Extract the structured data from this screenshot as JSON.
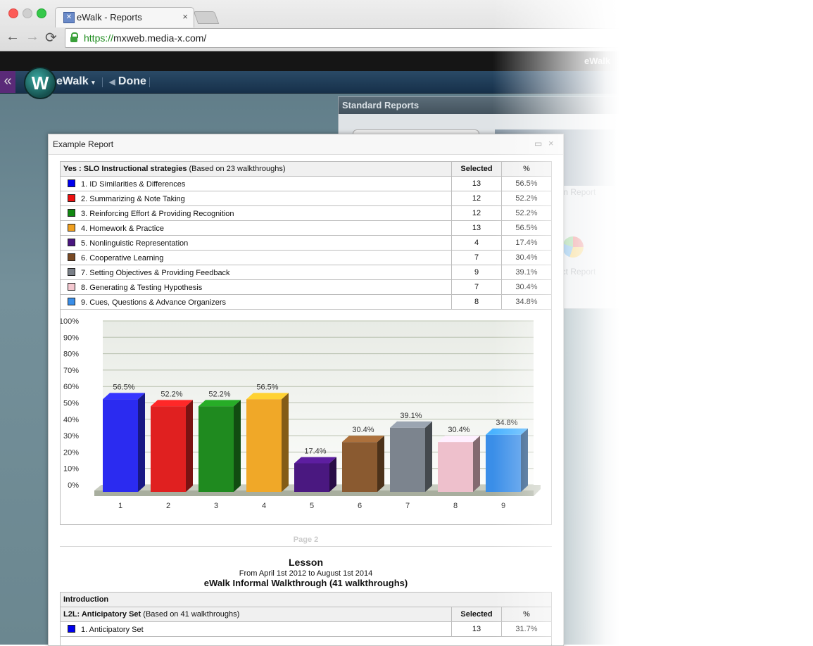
{
  "browser": {
    "tab_title": "eWalk - Reports",
    "tab_close": "×",
    "url_scheme": "https://",
    "url_rest": "mxweb.media-x.com/",
    "back_glyph": "←",
    "forward_glyph": "→",
    "reload_glyph": "⟳",
    "icons": [
      "back-icon",
      "forward-icon",
      "reload-icon",
      "lock-icon",
      "favicon"
    ]
  },
  "app": {
    "brand": "eWalk",
    "menu_app": "eWalk",
    "menu_done": "Done",
    "back_glyph": "«",
    "logo_letter": "W",
    "done_glyph": "◀"
  },
  "background_panel": {
    "title": "Standard Reports",
    "label_1": "ion Report",
    "label_2": "ect Report"
  },
  "modal": {
    "title": "Example Report",
    "max_glyph": "🗖",
    "close_glyph": "×"
  },
  "report": {
    "header_bold": "Yes : SLO Instructional strategies",
    "header_normal": "(Based on 23 walkthroughs)",
    "col_selected": "Selected",
    "col_pct": "%",
    "rows": [
      {
        "label": "1. ID Similarities & Differences",
        "selected": "13",
        "pct": "56.5%",
        "color": "#0000ee"
      },
      {
        "label": "2. Summarizing & Note Taking",
        "selected": "12",
        "pct": "52.2%",
        "color": "#ee1111"
      },
      {
        "label": "3. Reinforcing Effort & Providing Recognition",
        "selected": "12",
        "pct": "52.2%",
        "color": "#118811"
      },
      {
        "label": "4. Homework & Practice",
        "selected": "13",
        "pct": "56.5%",
        "color": "#f0a020"
      },
      {
        "label": "5. Nonlinguistic Representation",
        "selected": "4",
        "pct": "17.4%",
        "color": "#4a1680"
      },
      {
        "label": "6. Cooperative Learning",
        "selected": "7",
        "pct": "30.4%",
        "color": "#7a4a24"
      },
      {
        "label": "7. Setting Objectives & Providing Feedback",
        "selected": "9",
        "pct": "39.1%",
        "color": "#7a8088"
      },
      {
        "label": "8. Generating & Testing Hypothesis",
        "selected": "7",
        "pct": "30.4%",
        "color": "#f4c8d0"
      },
      {
        "label": "9. Cues, Questions & Advance Organizers",
        "selected": "8",
        "pct": "34.8%",
        "color": "#3a8ee8"
      }
    ]
  },
  "chart_data": {
    "type": "bar",
    "categories": [
      "1",
      "2",
      "3",
      "4",
      "5",
      "6",
      "7",
      "8",
      "9"
    ],
    "values": [
      56.5,
      52.2,
      52.2,
      56.5,
      17.4,
      30.4,
      39.1,
      30.4,
      34.8
    ],
    "value_labels": [
      "56.5%",
      "52.2%",
      "52.2%",
      "56.5%",
      "17.4%",
      "30.4%",
      "39.1%",
      "30.4%",
      "34.8%"
    ],
    "colors": [
      "#2b2bf0",
      "#e02020",
      "#1f8a1f",
      "#f0a828",
      "#4a1880",
      "#8a5a30",
      "#7c848e",
      "#eec0cc",
      "#3a8ee8"
    ],
    "y_ticks": [
      "0%",
      "10%",
      "20%",
      "30%",
      "40%",
      "50%",
      "60%",
      "70%",
      "80%",
      "90%",
      "100%"
    ],
    "ylim": [
      0,
      100
    ],
    "grid": true,
    "title": "",
    "xlabel": "",
    "ylabel": ""
  },
  "page2": {
    "page_label": "Page 2",
    "lesson_title": "Lesson",
    "date_range": "From April 1st 2012 to August 1st 2014",
    "subtitle": "eWalk Informal Walkthrough (41 walkthroughs)",
    "section": "Introduction",
    "header_bold": "L2L: Anticipatory Set",
    "header_normal": "(Based on 41 walkthroughs)",
    "col_selected": "Selected",
    "col_pct": "%",
    "rows": [
      {
        "label": "1. Anticipatory Set",
        "selected": "13",
        "pct": "31.7%",
        "color": "#0000ee"
      }
    ]
  }
}
